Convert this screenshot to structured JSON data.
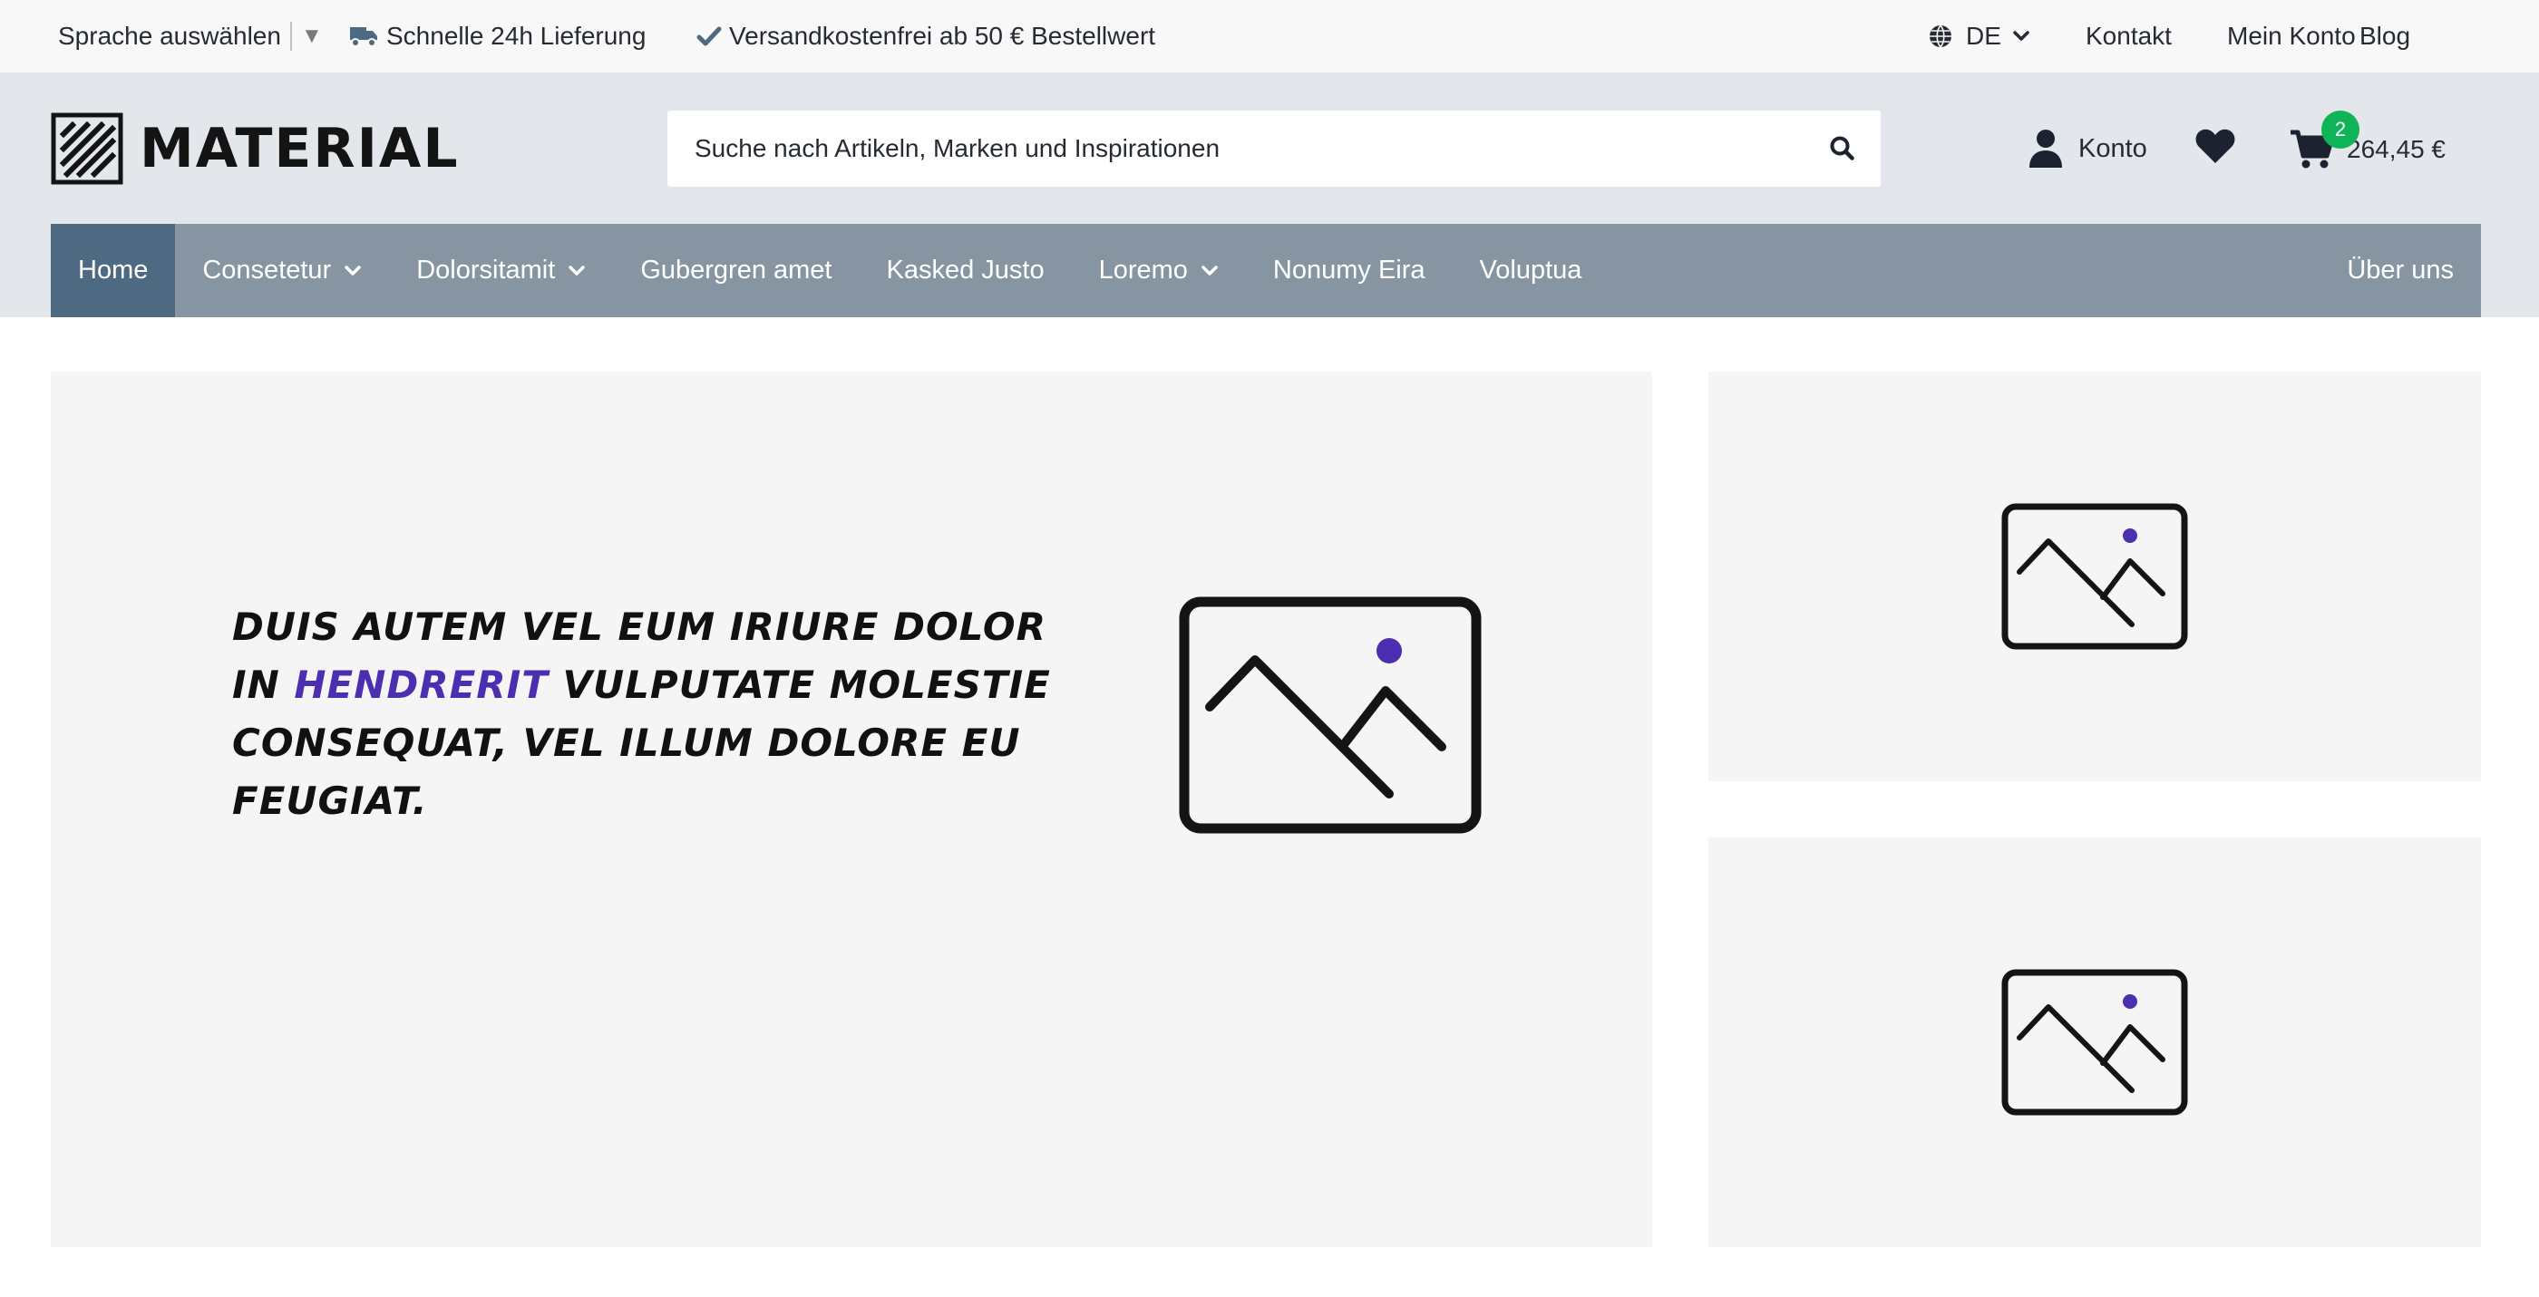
{
  "topbar": {
    "language_label": "Sprache auswählen",
    "usp_delivery": "Schnelle 24h Lieferung",
    "usp_shipping": "Versandkostenfrei ab 50 € Bestellwert",
    "locale": "DE",
    "links": [
      "Kontakt",
      "Mein Konto",
      "Blog"
    ]
  },
  "header": {
    "logo_text": "MATERIAL",
    "search_placeholder": "Suche nach Artikeln, Marken und Inspirationen",
    "account_label": "Konto",
    "cart_count": "2",
    "cart_total": "264,45 €"
  },
  "nav": {
    "items": [
      {
        "label": "Home",
        "active": true,
        "dropdown": false
      },
      {
        "label": "Consetetur",
        "active": false,
        "dropdown": true
      },
      {
        "label": "Dolorsitamit",
        "active": false,
        "dropdown": true
      },
      {
        "label": "Gubergren amet",
        "active": false,
        "dropdown": false
      },
      {
        "label": "Kasked Justo",
        "active": false,
        "dropdown": false
      },
      {
        "label": "Loremo",
        "active": false,
        "dropdown": true
      },
      {
        "label": "Nonumy Eira",
        "active": false,
        "dropdown": false
      },
      {
        "label": "Voluptua",
        "active": false,
        "dropdown": false
      }
    ],
    "right_item": "Über uns"
  },
  "hero": {
    "text_before": "DUIS AUTEM VEL EUM IRIURE DOLOR IN ",
    "text_accent": "HENDRERIT",
    "text_after": " VULPUTATE MOLESTIE CONSEQUAT, VEL ILLUM DOLORE EU FEUGIAT."
  },
  "icons": {
    "delivery": "truck-icon",
    "shipping": "check-icon",
    "locale": "globe-icon",
    "search": "search-icon",
    "account": "user-icon",
    "wishlist": "heart-icon",
    "cart": "cart-icon",
    "placeholder_image": "image-placeholder-icon"
  },
  "colors": {
    "nav_bg": "#8795a2",
    "nav_active": "#4e6a82",
    "header_bg": "#e3e7ec",
    "accent_purple": "#4b2fb0",
    "badge_green": "#0fb358"
  }
}
